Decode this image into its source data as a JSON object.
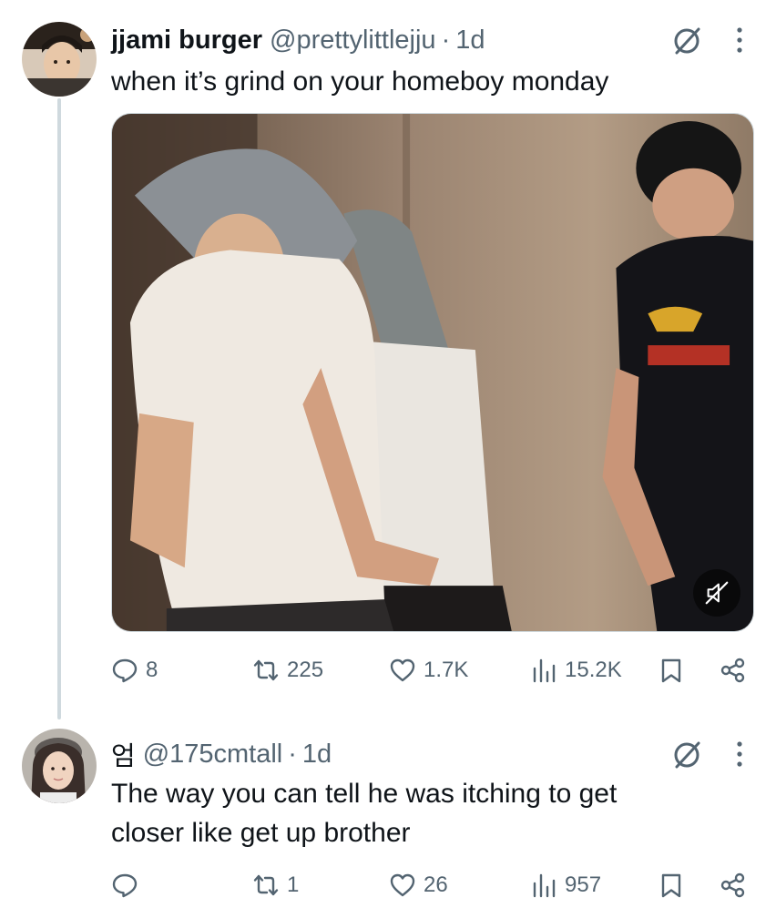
{
  "posts": [
    {
      "display_name": "jjami burger",
      "handle": "@prettylittlejju",
      "separator": "·",
      "time": "1d",
      "text": "when it’s grind on your homeboy monday",
      "media": {
        "type": "video",
        "muted": true
      },
      "stats": {
        "replies": "8",
        "reposts": "225",
        "likes": "1.7K",
        "views": "15.2K"
      }
    },
    {
      "display_name": "엄",
      "handle": "@175cmtall",
      "separator": "·",
      "time": "1d",
      "text_line1": "The way you can tell he was itching to get",
      "text_line2": "closer like get up brother",
      "stats": {
        "replies": "",
        "reposts": "1",
        "likes": "26",
        "views": "957"
      }
    }
  ],
  "icons": {
    "reply": "reply-icon",
    "repost": "repost-icon",
    "like": "heart-icon",
    "views": "views-icon",
    "bookmark": "bookmark-icon",
    "share": "share-icon",
    "grok": "grok-icon",
    "more": "more-icon",
    "mute": "mute-icon"
  },
  "colors": {
    "text": "#0f1419",
    "secondary": "#536471",
    "divider": "#cfd9de"
  }
}
